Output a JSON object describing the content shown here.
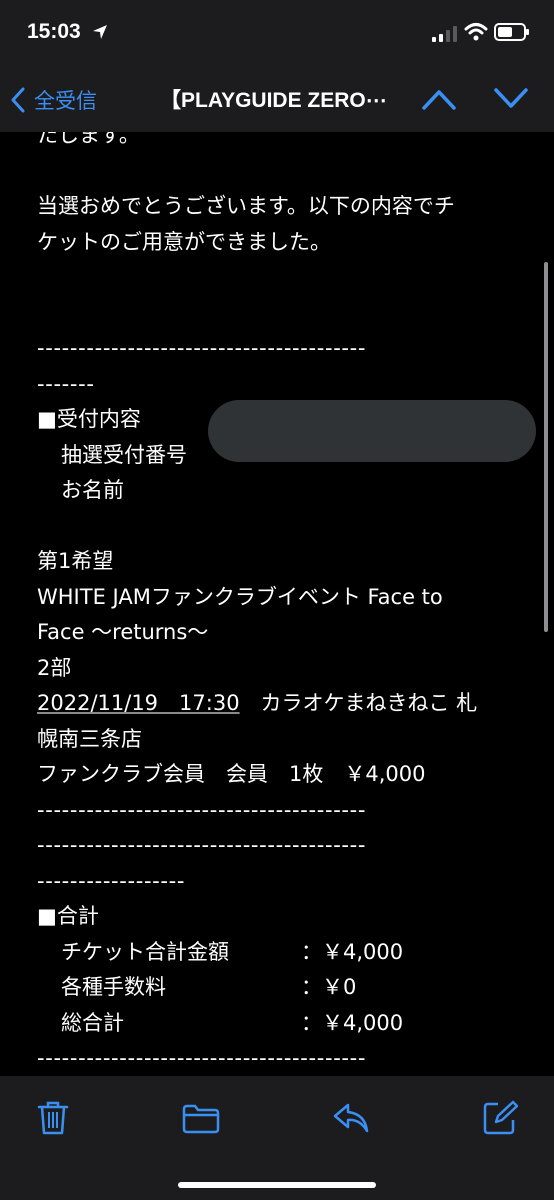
{
  "status_bar": {
    "time": "15:03"
  },
  "nav": {
    "back_label": "全受信",
    "title": "【PLAYGUIDE ZERO⋯"
  },
  "email": {
    "lines": [
      {
        "text": "たします。",
        "cls": ""
      },
      {
        "text": "",
        "cls": ""
      },
      {
        "text": "当選おめでとうございます。以下の内容でチ",
        "cls": ""
      },
      {
        "text": "ケットのご用意ができました。",
        "cls": ""
      },
      {
        "text": "",
        "cls": ""
      },
      {
        "text": "",
        "cls": ""
      },
      {
        "text": "----------------------------------------",
        "cls": "dash"
      },
      {
        "text": "-------",
        "cls": "dash"
      },
      {
        "text": "■受付内容",
        "cls": ""
      },
      {
        "text": "抽選受付番号",
        "cls": "ind"
      },
      {
        "text": "お名前",
        "cls": "ind"
      },
      {
        "text": "",
        "cls": ""
      },
      {
        "text": "第1希望",
        "cls": ""
      },
      {
        "text": "WHITE JAMファンクラブイベント Face to",
        "cls": ""
      },
      {
        "text": "Face ～returns～",
        "cls": ""
      },
      {
        "text": "2部",
        "cls": ""
      },
      {
        "text": "",
        "cls": "date"
      },
      {
        "text": "幌南三条店",
        "cls": ""
      },
      {
        "text": "ファンクラブ会員　会員　1枚　￥4,000",
        "cls": ""
      },
      {
        "text": "----------------------------------------",
        "cls": "dash"
      },
      {
        "text": "----------------------------------------",
        "cls": "dash"
      },
      {
        "text": "------------------",
        "cls": "dash"
      },
      {
        "text": "■合計",
        "cls": ""
      },
      {
        "text": "",
        "cls": "sum0"
      },
      {
        "text": "",
        "cls": "sum1"
      },
      {
        "text": "",
        "cls": "sum2"
      },
      {
        "text": "----------------------------------------",
        "cls": "dash"
      },
      {
        "text": "-------",
        "cls": "dash"
      }
    ],
    "date_link": "2022/11/19　17:30",
    "venue": "　カラオケまねきねこ 札",
    "summary": [
      {
        "label": "チケット合計金額",
        "value": "：￥4,000"
      },
      {
        "label": "各種手数料",
        "value": "：￥0"
      },
      {
        "label": "総合計",
        "value": "：￥4,000"
      }
    ]
  },
  "colors": {
    "accent": "#3a8ff3",
    "bar_bg": "#1c1c1e",
    "redaction": "#2f3335"
  },
  "toolbar": {
    "icons": [
      "trash-icon",
      "folder-icon",
      "reply-icon",
      "compose-icon"
    ]
  }
}
